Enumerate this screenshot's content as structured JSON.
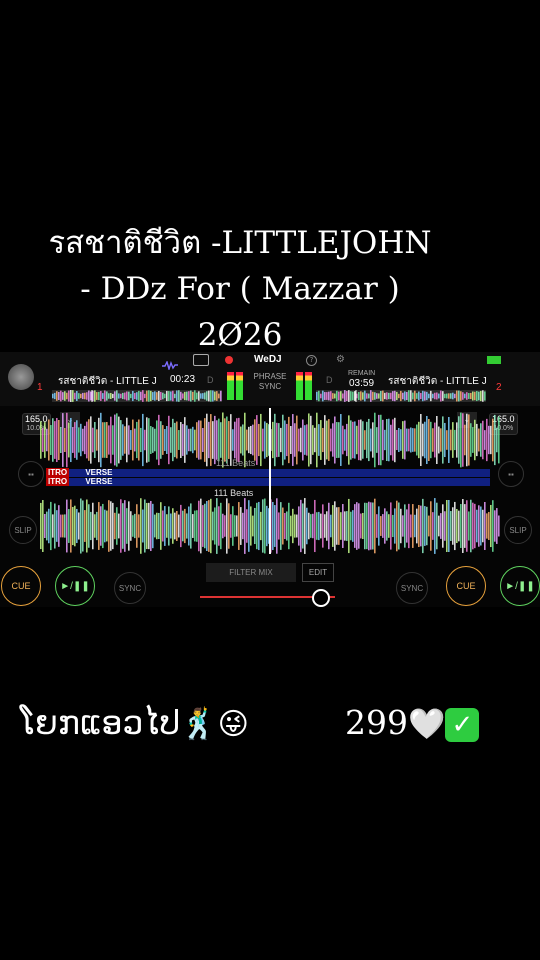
{
  "overlay_title": {
    "line1": "รสชาติชีวิต -LITTLEJOHN",
    "line2": "- DDz For ( Mazzar )",
    "line3": "2Ø26"
  },
  "app": {
    "brand": "WeDJ",
    "deck_left": {
      "number": "1",
      "track": "รสชาติชีวิต - LITTLE J",
      "elapsed": "00:23",
      "bpm": "165.0",
      "pitch": "10.0%",
      "mode": "D"
    },
    "deck_right": {
      "number": "2",
      "track": "รสชาติชีวิต - LITTLE J",
      "remain_label": "REMAIN",
      "remain": "03:59",
      "bpm": "165.0",
      "pitch": "10.0%",
      "mode": "D"
    },
    "phrase_sync": {
      "line1": "PHRASE",
      "line2": "SYNC"
    },
    "beats_top": "111 Beats",
    "beats_bottom": "111 Beats",
    "cue_labels": {
      "intro": "ITRO",
      "verse": "VERSE"
    },
    "buttons": {
      "slip": "SLIP",
      "cue": "CUE",
      "sync": "SYNC",
      "play": "►/❚❚",
      "filter_mix": "FILTER MIX",
      "edit": "EDIT"
    },
    "crossfader_value": 0.88,
    "colors": {
      "cue": "#e8a23c",
      "play": "#5fd35f",
      "deck_number": "#ff3b3b",
      "beat_grid": "#1a2a8a"
    }
  },
  "caption_left": "ໂຍກແອວໄປ",
  "caption_right": "299",
  "emojis": [
    "dancing-man-icon",
    "winking-tongue-face-icon",
    "white-heart-icon",
    "check-mark-button-icon"
  ]
}
